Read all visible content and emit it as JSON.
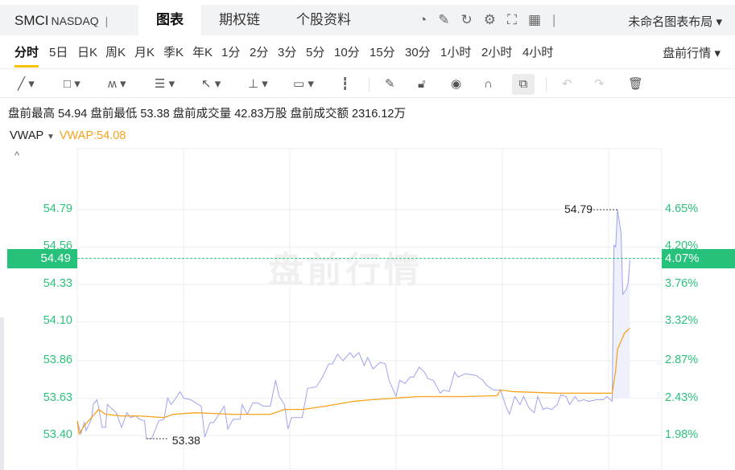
{
  "header": {
    "symbol": "SMCI",
    "exchange": "NASDAQ",
    "separator": "|",
    "tabs": [
      "图表",
      "期权链",
      "个股资料"
    ],
    "layout_label": "未命名图表布局 ▾",
    "icons": [
      "gauge-icon",
      "edit-icon",
      "refresh-icon",
      "settings-icon",
      "fullscreen-icon",
      "grid-layout-icon"
    ]
  },
  "periods": {
    "items": [
      "分时",
      "5日",
      "日K",
      "周K",
      "月K",
      "季K",
      "年K",
      "1分",
      "2分",
      "3分",
      "5分",
      "10分",
      "15分",
      "30分",
      "1小时",
      "2小时",
      "4小时"
    ],
    "active": 0,
    "session_label": "盘前行情 ▾"
  },
  "toolbar": {
    "tools": [
      "line-tool",
      "rectangle-tool",
      "pattern-tool",
      "fib-tool",
      "arrow-tool",
      "measure-tool",
      "text-tool",
      "candle-tool",
      "pencil-tool",
      "lock-tool",
      "eye-tool",
      "magnet-tool",
      "link-tool",
      "undo-tool",
      "redo-tool",
      "delete-tool"
    ]
  },
  "stats": "盘前最高 54.94 盘前最低 53.38 盘前成交量 42.83万股 盘前成交额 2316.12万",
  "indicator": {
    "name": "VWAP",
    "value": "VWAP:54.08",
    "collapse": "^"
  },
  "watermark": "盘前行情",
  "colors": {
    "price": "#9ea3ee",
    "vwap": "#f7a21b",
    "axis": "#2bc27a",
    "box": "#26c27c"
  },
  "chart_data": {
    "type": "line",
    "x_unit": "minutes since 04:00 premarket",
    "xlim": [
      0,
      330
    ],
    "ylim": [
      53.4,
      54.79
    ],
    "y_ticks": [
      "54.79",
      "54.56",
      "54.33",
      "54.10",
      "53.86",
      "53.63",
      "53.40"
    ],
    "y_tick_values": [
      54.79,
      54.56,
      54.33,
      54.1,
      53.86,
      53.63,
      53.4
    ],
    "pct_ticks": [
      "4.65%",
      "4.20%",
      "3.76%",
      "3.32%",
      "2.87%",
      "2.43%",
      "1.98%"
    ],
    "current": {
      "price": "54.49",
      "pct": "4.07%",
      "value": 54.49
    },
    "high_label": {
      "text": "54.79",
      "t": 305,
      "value": 54.79
    },
    "low_label": {
      "text": "53.38",
      "t": 39,
      "value": 53.38
    },
    "series": [
      {
        "name": "price",
        "points": [
          [
            0,
            53.49
          ],
          [
            2,
            53.41
          ],
          [
            4,
            53.48
          ],
          [
            5,
            53.43
          ],
          [
            8,
            53.5
          ],
          [
            9,
            53.59
          ],
          [
            11,
            53.62
          ],
          [
            12,
            53.58
          ],
          [
            14,
            53.45
          ],
          [
            16,
            53.45
          ],
          [
            17,
            53.59
          ],
          [
            20,
            53.56
          ],
          [
            22,
            53.54
          ],
          [
            25,
            53.45
          ],
          [
            28,
            53.54
          ],
          [
            30,
            53.51
          ],
          [
            33,
            53.52
          ],
          [
            35,
            53.5
          ],
          [
            38,
            53.49
          ],
          [
            39,
            53.38
          ],
          [
            42,
            53.38
          ],
          [
            46,
            53.49
          ],
          [
            49,
            53.5
          ],
          [
            51,
            53.63
          ],
          [
            53,
            53.59
          ],
          [
            55,
            53.62
          ],
          [
            58,
            53.67
          ],
          [
            60,
            53.63
          ],
          [
            64,
            53.62
          ],
          [
            67,
            53.6
          ],
          [
            70,
            53.58
          ],
          [
            72,
            53.39
          ],
          [
            75,
            53.48
          ],
          [
            77,
            53.48
          ],
          [
            80,
            53.53
          ],
          [
            83,
            53.58
          ],
          [
            85,
            53.44
          ],
          [
            88,
            53.5
          ],
          [
            92,
            53.5
          ],
          [
            93,
            53.59
          ],
          [
            96,
            53.53
          ],
          [
            99,
            53.6
          ],
          [
            102,
            53.6
          ],
          [
            105,
            53.58
          ],
          [
            109,
            53.58
          ],
          [
            112,
            53.74
          ],
          [
            114,
            53.64
          ],
          [
            117,
            53.59
          ],
          [
            119,
            53.44
          ],
          [
            121,
            53.51
          ],
          [
            127,
            53.51
          ],
          [
            130,
            53.69
          ],
          [
            135,
            53.7
          ],
          [
            138,
            53.75
          ],
          [
            142,
            53.84
          ],
          [
            144,
            53.84
          ],
          [
            147,
            53.9
          ],
          [
            150,
            53.86
          ],
          [
            154,
            53.91
          ],
          [
            156,
            53.88
          ],
          [
            159,
            53.91
          ],
          [
            162,
            53.83
          ],
          [
            164,
            53.88
          ],
          [
            167,
            53.81
          ],
          [
            171,
            53.85
          ],
          [
            174,
            53.84
          ],
          [
            176,
            53.74
          ],
          [
            180,
            53.64
          ],
          [
            182,
            53.74
          ],
          [
            185,
            53.72
          ],
          [
            188,
            53.76
          ],
          [
            190,
            53.76
          ],
          [
            193,
            53.82
          ],
          [
            196,
            53.79
          ],
          [
            198,
            53.75
          ],
          [
            201,
            53.74
          ],
          [
            205,
            53.66
          ],
          [
            207,
            53.68
          ],
          [
            210,
            53.67
          ],
          [
            213,
            53.79
          ],
          [
            215,
            53.76
          ],
          [
            219,
            53.78
          ],
          [
            225,
            53.77
          ],
          [
            229,
            53.74
          ],
          [
            231,
            53.71
          ],
          [
            235,
            53.68
          ],
          [
            239,
            53.68
          ],
          [
            242,
            53.58
          ],
          [
            244,
            53.53
          ],
          [
            247,
            53.64
          ],
          [
            250,
            53.59
          ],
          [
            252,
            53.64
          ],
          [
            255,
            53.57
          ],
          [
            258,
            53.54
          ],
          [
            260,
            53.64
          ],
          [
            263,
            53.56
          ],
          [
            265,
            53.57
          ],
          [
            268,
            53.56
          ],
          [
            271,
            53.59
          ],
          [
            273,
            53.65
          ],
          [
            276,
            53.64
          ],
          [
            278,
            53.59
          ],
          [
            281,
            53.64
          ],
          [
            283,
            53.61
          ],
          [
            286,
            53.62
          ],
          [
            289,
            53.61
          ],
          [
            293,
            53.62
          ],
          [
            297,
            53.62
          ],
          [
            299,
            53.64
          ],
          [
            302,
            53.61
          ],
          [
            303,
            54.57
          ],
          [
            304,
            54.56
          ],
          [
            305,
            54.79
          ],
          [
            307,
            54.65
          ],
          [
            308,
            54.27
          ],
          [
            310,
            54.3
          ],
          [
            311,
            54.34
          ],
          [
            312,
            54.48
          ]
        ]
      },
      {
        "name": "VWAP",
        "points": [
          [
            0,
            53.49
          ],
          [
            1,
            53.41
          ],
          [
            4,
            53.46
          ],
          [
            8,
            53.51
          ],
          [
            12,
            53.56
          ],
          [
            16,
            53.53
          ],
          [
            25,
            53.52
          ],
          [
            35,
            53.52
          ],
          [
            49,
            53.51
          ],
          [
            54,
            53.53
          ],
          [
            67,
            53.54
          ],
          [
            88,
            53.53
          ],
          [
            109,
            53.53
          ],
          [
            117,
            53.56
          ],
          [
            127,
            53.56
          ],
          [
            140,
            53.58
          ],
          [
            156,
            53.61
          ],
          [
            166,
            53.62
          ],
          [
            180,
            53.63
          ],
          [
            193,
            53.64
          ],
          [
            219,
            53.64
          ],
          [
            237,
            53.645
          ],
          [
            239,
            53.68
          ],
          [
            246,
            53.67
          ],
          [
            272,
            53.66
          ],
          [
            302,
            53.66
          ],
          [
            304,
            53.8
          ],
          [
            305,
            53.93
          ],
          [
            307,
            53.98
          ],
          [
            309,
            54.03
          ],
          [
            312,
            54.06
          ]
        ]
      }
    ]
  }
}
